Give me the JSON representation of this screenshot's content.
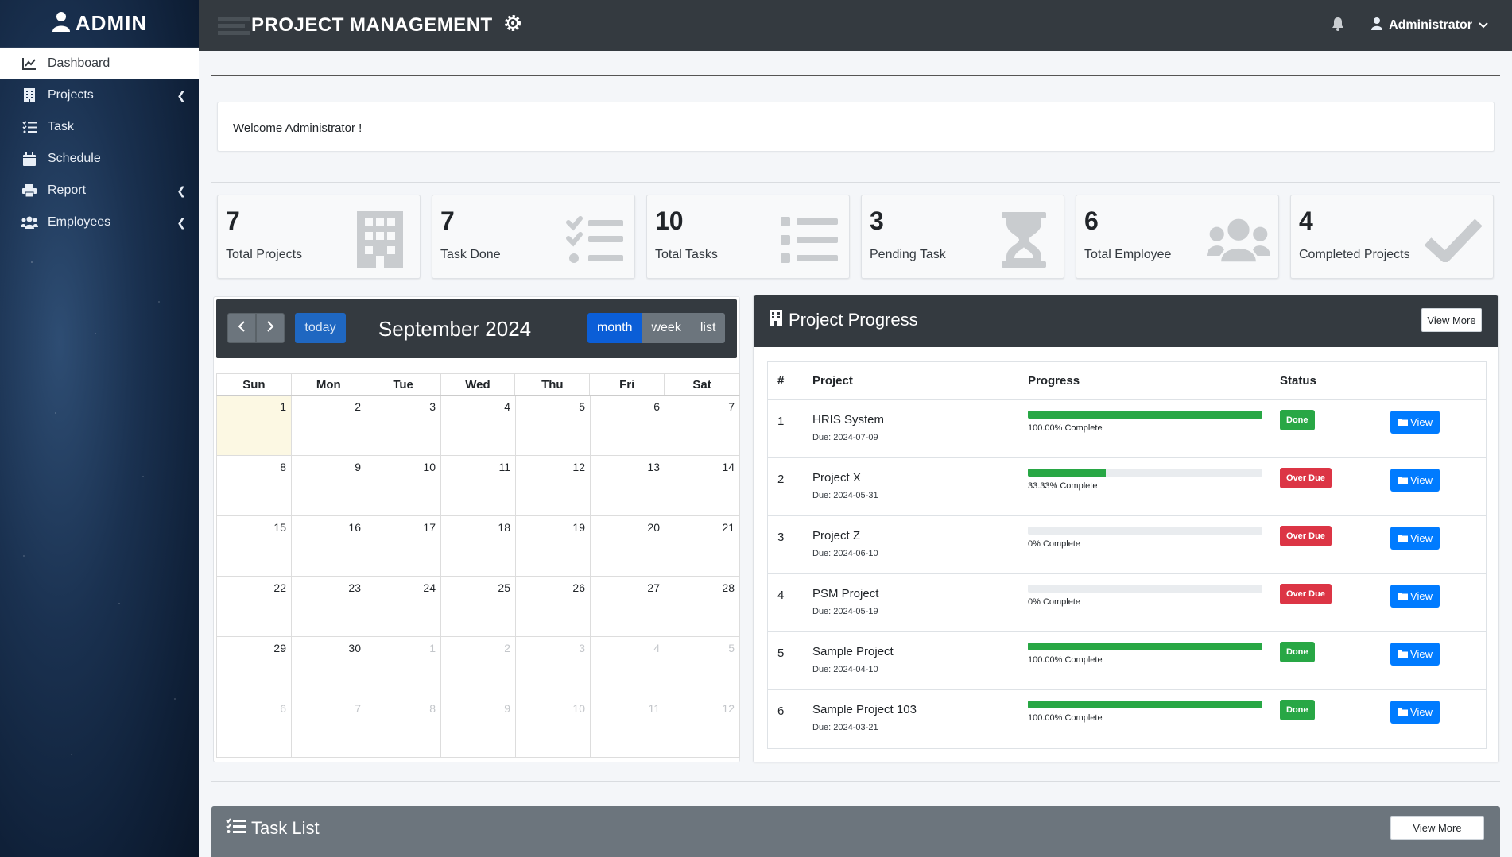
{
  "brand": {
    "title": "ADMIN"
  },
  "sidebar": {
    "items": [
      {
        "label": "Dashboard",
        "icon": "chart-line-icon",
        "active": true
      },
      {
        "label": "Projects",
        "icon": "building-icon",
        "caret": true
      },
      {
        "label": "Task",
        "icon": "tasks-icon"
      },
      {
        "label": "Schedule",
        "icon": "calendar-icon"
      },
      {
        "label": "Report",
        "icon": "print-icon",
        "caret": true
      },
      {
        "label": "Employees",
        "icon": "users-icon",
        "caret": true
      }
    ]
  },
  "topbar": {
    "title": "PROJECT MANAGEMENT",
    "user": "Administrator"
  },
  "welcome": {
    "text": "Welcome Administrator !"
  },
  "stats": [
    {
      "value": "7",
      "label": "Total Projects",
      "icon": "building-icon"
    },
    {
      "value": "7",
      "label": "Task Done",
      "icon": "tasks-icon"
    },
    {
      "value": "10",
      "label": "Total Tasks",
      "icon": "list-icon"
    },
    {
      "value": "3",
      "label": "Pending Task",
      "icon": "hourglass-icon"
    },
    {
      "value": "6",
      "label": "Total Employee",
      "icon": "users-icon"
    },
    {
      "value": "4",
      "label": "Completed Projects",
      "icon": "check-icon"
    }
  ],
  "calendar": {
    "title": "September 2024",
    "today_label": "today",
    "views": [
      "month",
      "week",
      "list"
    ],
    "active_view": "month",
    "days_of_week": [
      "Sun",
      "Mon",
      "Tue",
      "Wed",
      "Thu",
      "Fri",
      "Sat"
    ],
    "weeks": [
      [
        "1",
        "2",
        "3",
        "4",
        "5",
        "6",
        "7"
      ],
      [
        "8",
        "9",
        "10",
        "11",
        "12",
        "13",
        "14"
      ],
      [
        "15",
        "16",
        "17",
        "18",
        "19",
        "20",
        "21"
      ],
      [
        "22",
        "23",
        "24",
        "25",
        "26",
        "27",
        "28"
      ],
      [
        "29",
        "30",
        "1",
        "2",
        "3",
        "4",
        "5"
      ],
      [
        "6",
        "7",
        "8",
        "9",
        "10",
        "11",
        "12"
      ]
    ]
  },
  "project_progress": {
    "title": "Project Progress",
    "view_more": "View More",
    "headers": {
      "num": "#",
      "project": "Project",
      "progress": "Progress",
      "status": "Status"
    },
    "view_label": "View",
    "rows": [
      {
        "num": "1",
        "name": "HRIS System",
        "due": "Due: 2024-07-09",
        "progress": 100,
        "progress_text": "100.00% Complete",
        "status": "Done"
      },
      {
        "num": "2",
        "name": "Project X",
        "due": "Due: 2024-05-31",
        "progress": 33.33,
        "progress_text": "33.33% Complete",
        "status": "Over Due"
      },
      {
        "num": "3",
        "name": "Project Z",
        "due": "Due: 2024-06-10",
        "progress": 0,
        "progress_text": "0% Complete",
        "status": "Over Due"
      },
      {
        "num": "4",
        "name": "PSM Project",
        "due": "Due: 2024-05-19",
        "progress": 0,
        "progress_text": "0% Complete",
        "status": "Over Due"
      },
      {
        "num": "5",
        "name": "Sample Project",
        "due": "Due: 2024-04-10",
        "progress": 100,
        "progress_text": "100.00% Complete",
        "status": "Done"
      },
      {
        "num": "6",
        "name": "Sample Project 103",
        "due": "Due: 2024-03-21",
        "progress": 100,
        "progress_text": "100.00% Complete",
        "status": "Done"
      }
    ]
  },
  "task_list": {
    "title": "Task List",
    "view_more": "View More"
  },
  "colors": {
    "dark": "#343a40",
    "primary": "#007bff",
    "success": "#28a745",
    "danger": "#dc3545",
    "secondary": "#6c757d"
  }
}
